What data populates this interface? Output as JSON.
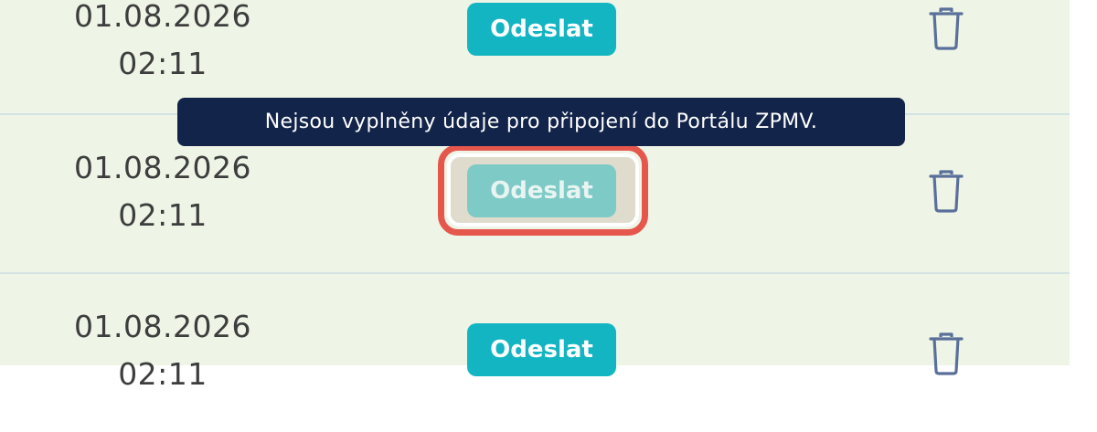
{
  "rows": [
    {
      "date": "01.08.2026",
      "time": "02:11",
      "send_label": "Odeslat",
      "send_enabled": true
    },
    {
      "date": "01.08.2026",
      "time": "02:11",
      "send_label": "Odeslat",
      "send_enabled": false
    },
    {
      "date": "01.08.2026",
      "time": "02:11",
      "send_label": "Odeslat",
      "send_enabled": true
    }
  ],
  "tooltip": {
    "text": "Nejsou vyplněny údaje pro připojení do Portálu ZPMV."
  },
  "icons": {
    "delete": "trash-icon"
  },
  "colors": {
    "row_background": "#eef4e6",
    "send_button": "#13b5c2",
    "send_button_disabled": "#7ecac6",
    "tooltip_background": "#13244a",
    "highlight": "#e5574d",
    "trash_icon": "#5a6f9a"
  }
}
